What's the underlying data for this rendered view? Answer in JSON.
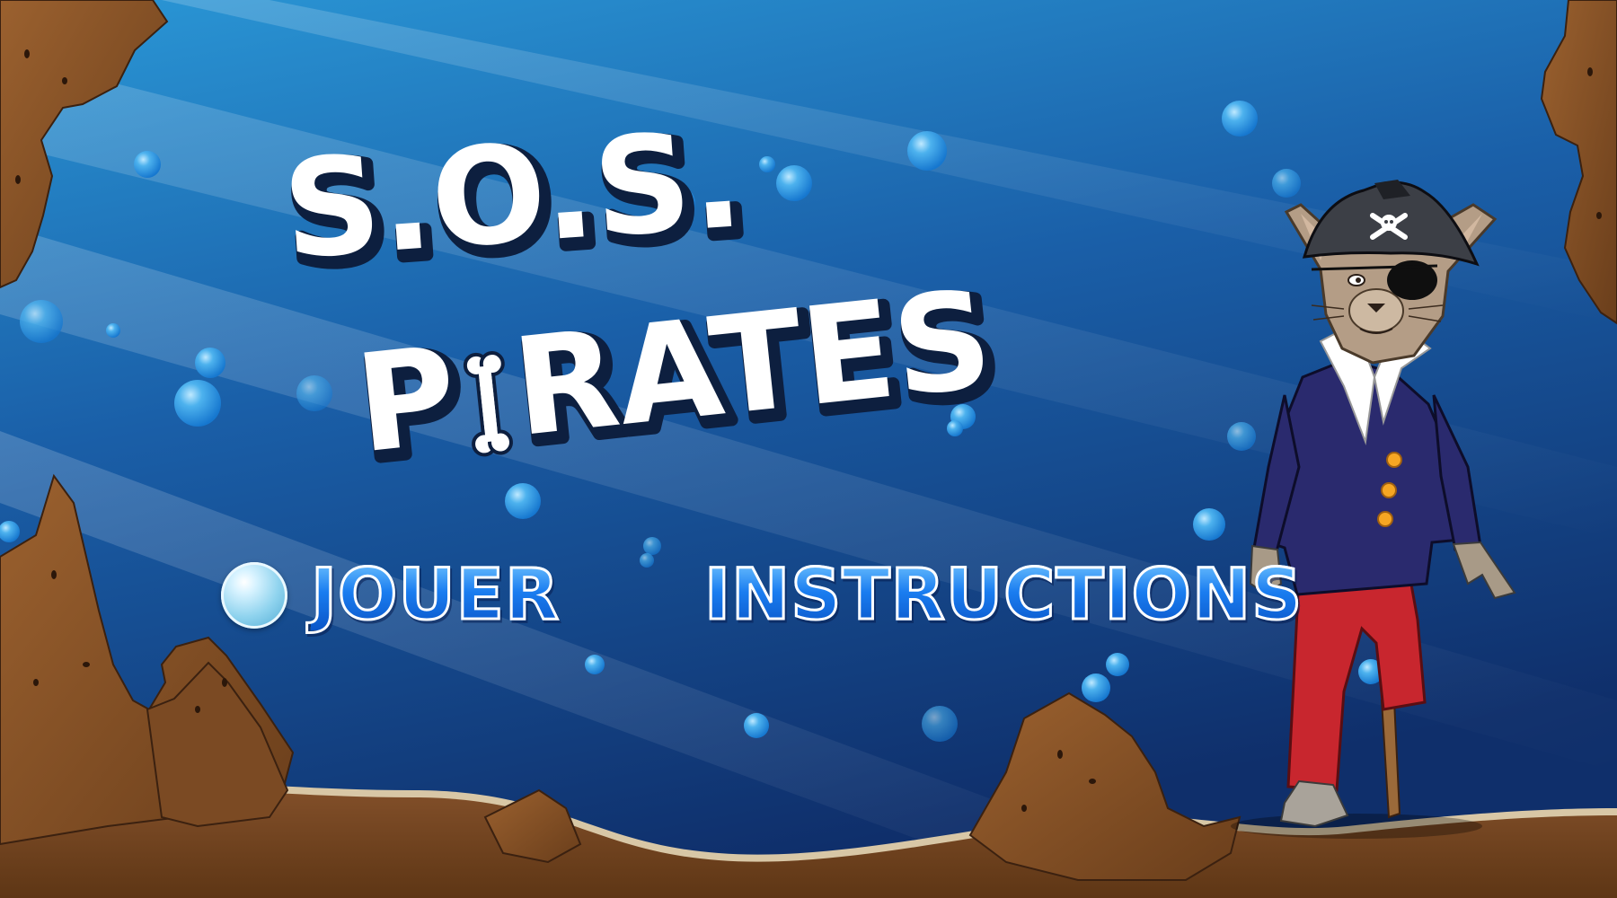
{
  "game": {
    "title_line1": "S.O.S.",
    "title_line2_prefix": "P",
    "title_line2_suffix": "RATES"
  },
  "menu": {
    "play_label": "JOUER",
    "instructions_label": "INSTRUCTIONS",
    "selected_item": "play"
  },
  "colors": {
    "water_top": "#2a97d6",
    "water_bottom": "#0f2f6b",
    "sand": "#7a4a22",
    "rock": "#8a5429",
    "title_fill": "#ffffff",
    "title_outline": "#0d1f3f",
    "menu_text": "#1a7df0",
    "pirate_coat": "#2a2a6e",
    "pirate_pants": "#c8262e",
    "pirate_buttons": "#f6a623"
  },
  "character": {
    "icon": "pirate-cat-icon",
    "hat_emblem": "skull-crossbones-icon"
  }
}
